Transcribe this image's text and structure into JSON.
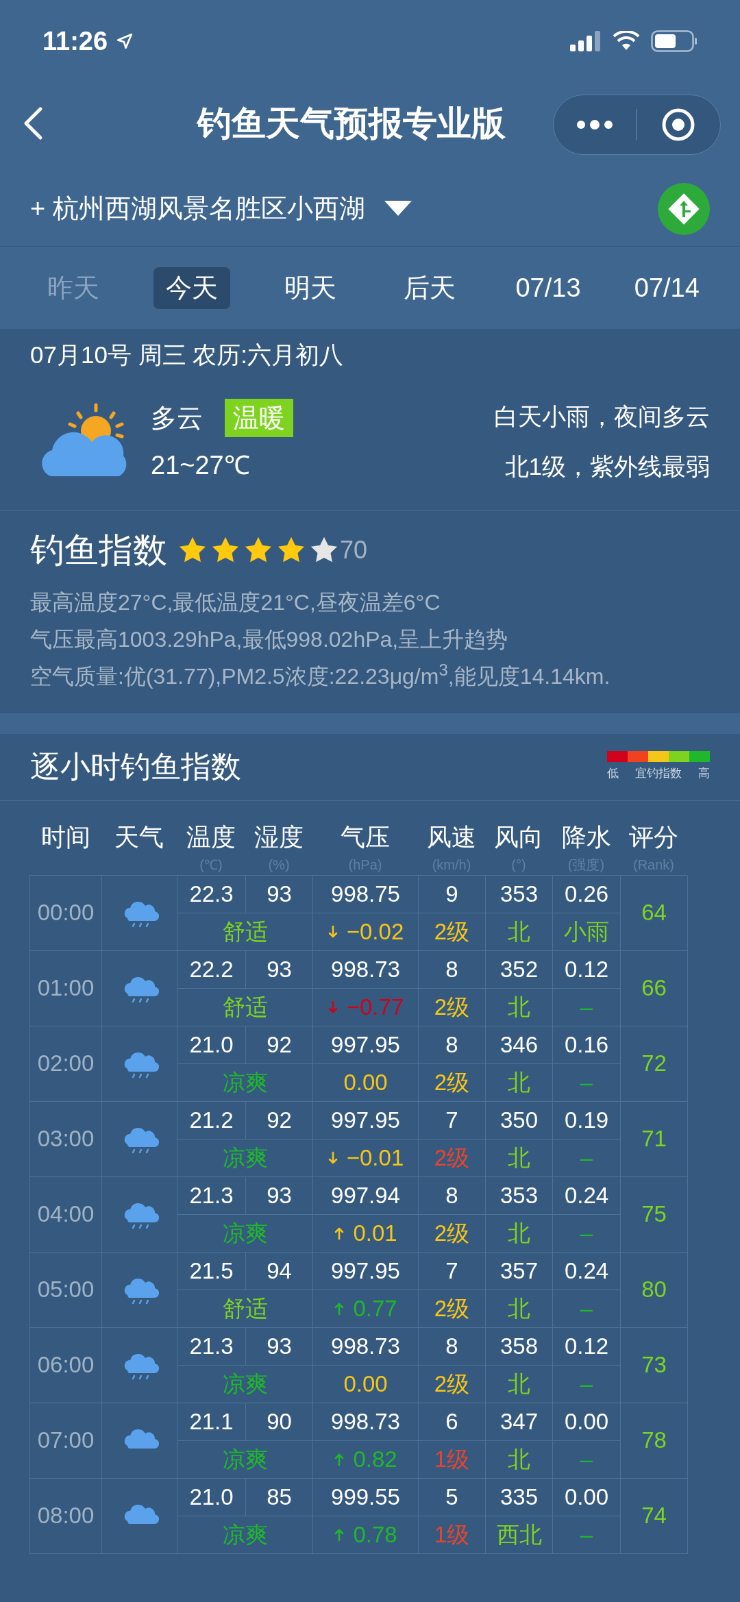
{
  "status_bar": {
    "time": "11:26"
  },
  "nav": {
    "title": "钓鱼天气预报专业版"
  },
  "location": {
    "prefix": "+",
    "name": "杭州西湖风景名胜区小西湖"
  },
  "day_tabs": [
    {
      "label": "昨天",
      "selected": false,
      "disabled": true
    },
    {
      "label": "今天",
      "selected": true,
      "disabled": false
    },
    {
      "label": "明天",
      "selected": false,
      "disabled": false
    },
    {
      "label": "后天",
      "selected": false,
      "disabled": false
    },
    {
      "label": "07/13",
      "selected": false,
      "disabled": false
    },
    {
      "label": "07/14",
      "selected": false,
      "disabled": false
    }
  ],
  "today": {
    "date": "07月10号 周三 农历:六月初八",
    "condition": "多云",
    "feel_tag": "温暖",
    "temp_range": "21~27℃",
    "summary": "白天小雨，夜间多云",
    "wind_uv": "北1级，紫外线最弱"
  },
  "fishing_index": {
    "title": "钓鱼指数",
    "stars": 4,
    "score": "70",
    "details": [
      "最高温度27°C,最低温度21°C,昼夜温差6°C",
      "气压最高1003.29hPa,最低998.02hPa,呈上升趋势",
      "空气质量:优(31.77),PM2.5浓度:22.23μg/m$^{3}$,能见度14.14km."
    ]
  },
  "hourly": {
    "title": "逐小时钓鱼指数",
    "legend": {
      "swatches": [
        {
          "color": "#d0021b"
        },
        {
          "color": "#f0421e"
        },
        {
          "color": "#f5c518"
        },
        {
          "color": "#7ed321"
        },
        {
          "color": "#1fb82a"
        }
      ],
      "low": "低",
      "middle": "宜钓指数",
      "high": "高"
    },
    "columns": [
      {
        "label": "时间"
      },
      {
        "label": "天气"
      },
      {
        "label": "温度",
        "unit": "(℃)"
      },
      {
        "label": "湿度",
        "unit": "(%)"
      },
      {
        "label": "气压",
        "unit": "(hPa)"
      },
      {
        "label": "风速",
        "unit": "(km/h)"
      },
      {
        "label": "风向",
        "unit": "(°)"
      },
      {
        "label": "降水",
        "unit": "(强度)"
      },
      {
        "label": "评分",
        "unit": "(Rank)"
      }
    ],
    "rows": [
      {
        "time": "00:00",
        "weather": {
          "kind": "rain"
        },
        "temp": "22.3",
        "humidity": "93",
        "pressure": "998.75",
        "wind_speed": "9",
        "wind_dir": "353",
        "rain": "0.26",
        "comfort": {
          "text": "舒适",
          "color": "#7ed321"
        },
        "pressure_change": {
          "kind": "down",
          "text": "−0.02",
          "color": "#f5c518"
        },
        "wind_level": {
          "text": "2级",
          "color": "#f5c518"
        },
        "dir_text": {
          "text": "北",
          "color": "#7ed321"
        },
        "rain_text": {
          "text": "小雨",
          "color": "#7ed321"
        },
        "score": "64"
      },
      {
        "time": "01:00",
        "weather": {
          "kind": "rain"
        },
        "temp": "22.2",
        "humidity": "93",
        "pressure": "998.73",
        "wind_speed": "8",
        "wind_dir": "352",
        "rain": "0.12",
        "comfort": {
          "text": "舒适",
          "color": "#7ed321"
        },
        "pressure_change": {
          "kind": "down",
          "text": "−0.77",
          "color": "#d0021b"
        },
        "wind_level": {
          "text": "2级",
          "color": "#f5c518"
        },
        "dir_text": {
          "text": "北",
          "color": "#7ed321"
        },
        "rain_text": {
          "text": "–",
          "color": "#1fb82a"
        },
        "score": "66"
      },
      {
        "time": "02:00",
        "weather": {
          "kind": "rain"
        },
        "temp": "21.0",
        "humidity": "92",
        "pressure": "997.95",
        "wind_speed": "8",
        "wind_dir": "346",
        "rain": "0.16",
        "comfort": {
          "text": "凉爽",
          "color": "#1fb82a"
        },
        "pressure_change": {
          "kind": "none",
          "text": "0.00",
          "color": "#f5c518"
        },
        "wind_level": {
          "text": "2级",
          "color": "#f5c518"
        },
        "dir_text": {
          "text": "北",
          "color": "#7ed321"
        },
        "rain_text": {
          "text": "–",
          "color": "#1fb82a"
        },
        "score": "72"
      },
      {
        "time": "03:00",
        "weather": {
          "kind": "rain"
        },
        "temp": "21.2",
        "humidity": "92",
        "pressure": "997.95",
        "wind_speed": "7",
        "wind_dir": "350",
        "rain": "0.19",
        "comfort": {
          "text": "凉爽",
          "color": "#1fb82a"
        },
        "pressure_change": {
          "kind": "down",
          "text": "−0.01",
          "color": "#f5c518"
        },
        "wind_level": {
          "text": "2级",
          "color": "#e8442b"
        },
        "dir_text": {
          "text": "北",
          "color": "#7ed321"
        },
        "rain_text": {
          "text": "–",
          "color": "#1fb82a"
        },
        "score": "71"
      },
      {
        "time": "04:00",
        "weather": {
          "kind": "rain"
        },
        "temp": "21.3",
        "humidity": "93",
        "pressure": "997.94",
        "wind_speed": "8",
        "wind_dir": "353",
        "rain": "0.24",
        "comfort": {
          "text": "凉爽",
          "color": "#1fb82a"
        },
        "pressure_change": {
          "kind": "up",
          "text": "0.01",
          "color": "#f5c518"
        },
        "wind_level": {
          "text": "2级",
          "color": "#f5c518"
        },
        "dir_text": {
          "text": "北",
          "color": "#7ed321"
        },
        "rain_text": {
          "text": "–",
          "color": "#1fb82a"
        },
        "score": "75"
      },
      {
        "time": "05:00",
        "weather": {
          "kind": "rain"
        },
        "temp": "21.5",
        "humidity": "94",
        "pressure": "997.95",
        "wind_speed": "7",
        "wind_dir": "357",
        "rain": "0.24",
        "comfort": {
          "text": "舒适",
          "color": "#7ed321"
        },
        "pressure_change": {
          "kind": "up",
          "text": "0.77",
          "color": "#1fb82a"
        },
        "wind_level": {
          "text": "2级",
          "color": "#f5c518"
        },
        "dir_text": {
          "text": "北",
          "color": "#7ed321"
        },
        "rain_text": {
          "text": "–",
          "color": "#1fb82a"
        },
        "score": "80"
      },
      {
        "time": "06:00",
        "weather": {
          "kind": "rain"
        },
        "temp": "21.3",
        "humidity": "93",
        "pressure": "998.73",
        "wind_speed": "8",
        "wind_dir": "358",
        "rain": "0.12",
        "comfort": {
          "text": "凉爽",
          "color": "#1fb82a"
        },
        "pressure_change": {
          "kind": "none",
          "text": "0.00",
          "color": "#f5c518"
        },
        "wind_level": {
          "text": "2级",
          "color": "#f5c518"
        },
        "dir_text": {
          "text": "北",
          "color": "#7ed321"
        },
        "rain_text": {
          "text": "–",
          "color": "#1fb82a"
        },
        "score": "73"
      },
      {
        "time": "07:00",
        "weather": {
          "kind": "cloud"
        },
        "temp": "21.1",
        "humidity": "90",
        "pressure": "998.73",
        "wind_speed": "6",
        "wind_dir": "347",
        "rain": "0.00",
        "comfort": {
          "text": "凉爽",
          "color": "#1fb82a"
        },
        "pressure_change": {
          "kind": "up",
          "text": "0.82",
          "color": "#1fb82a"
        },
        "wind_level": {
          "text": "1级",
          "color": "#e8442b"
        },
        "dir_text": {
          "text": "北",
          "color": "#7ed321"
        },
        "rain_text": {
          "text": "–",
          "color": "#1fb82a"
        },
        "score": "78"
      },
      {
        "time": "08:00",
        "weather": {
          "kind": "cloud"
        },
        "temp": "21.0",
        "humidity": "85",
        "pressure": "999.55",
        "wind_speed": "5",
        "wind_dir": "335",
        "rain": "0.00",
        "comfort": {
          "text": "凉爽",
          "color": "#1fb82a"
        },
        "pressure_change": {
          "kind": "up",
          "text": "0.78",
          "color": "#1fb82a"
        },
        "wind_level": {
          "text": "1级",
          "color": "#e8442b"
        },
        "dir_text": {
          "text": "西北",
          "color": "#7ed321"
        },
        "rain_text": {
          "text": "–",
          "color": "#1fb82a"
        },
        "score": "74"
      }
    ]
  }
}
